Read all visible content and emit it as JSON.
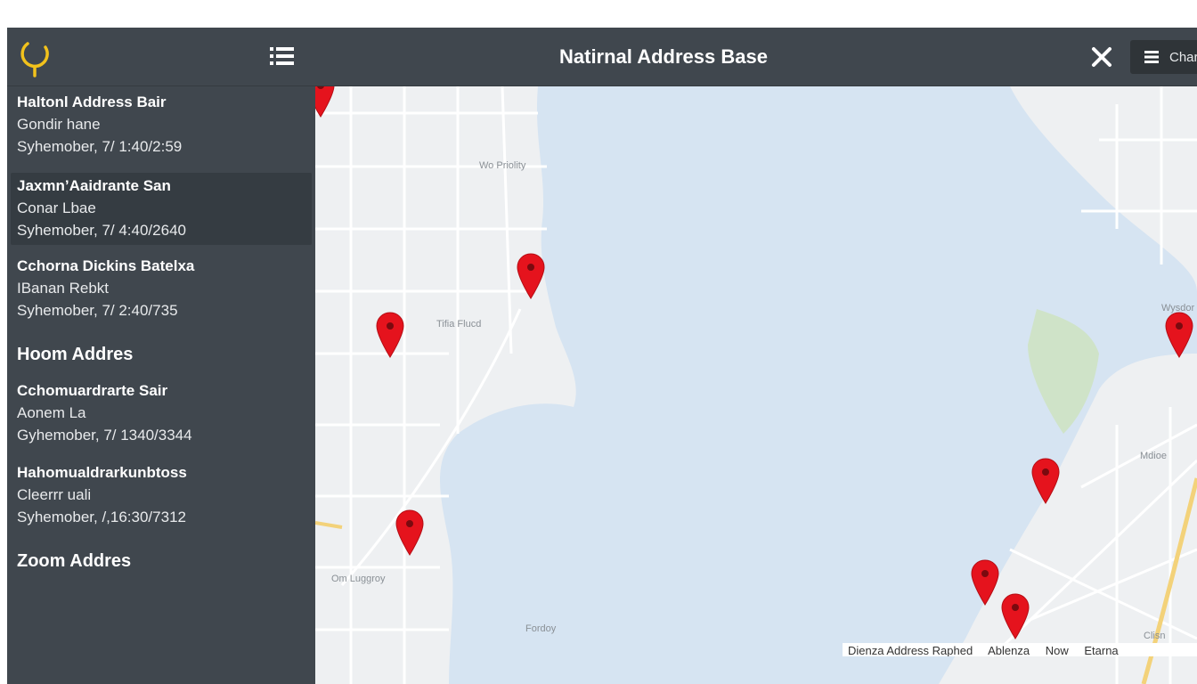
{
  "header": {
    "title": "Natirnal Address Base",
    "chart_label": "Chart"
  },
  "sidebar": {
    "entries": [
      {
        "name": "Haltonl Address Bair",
        "sub": "Gondir hane",
        "date": "Syhemober, 7/ 1:40/2:59"
      },
      {
        "name": "Jaxmn’Aaidrante San",
        "sub": "Conar Lbae",
        "date": "Syhemober, 7/ 4:40/2640"
      },
      {
        "name": "Cchorna Dickins Batelxa",
        "sub": "IBanan Rebkt",
        "date": "Syhemober, 7/ 2:40/735"
      },
      {
        "name": "Cchomuardrarte Sair",
        "sub": "Aonem La",
        "date": "Gyhemober, 7/ 1340/3344"
      },
      {
        "name": "Hahomualdrarkunbtoss",
        "sub": "Cleerrr uali",
        "date": "Syhemober, /,16:30/7312"
      }
    ],
    "sections": [
      "Hoom Addres",
      "Zoom Addres"
    ]
  },
  "map": {
    "water_color": "#d6e4f2",
    "land_color": "#eef0f2",
    "pin_color": "#e5131d",
    "labels": [
      "Wo Priolity",
      "Tifia Flucd",
      "Om Luggroy",
      "Fordoy",
      "Mdioe",
      "Wysdor",
      "Clisn"
    ]
  },
  "attribution": {
    "items": [
      "Dienza Address Raphed",
      "Ablenza",
      "Now",
      "Etarna"
    ]
  }
}
